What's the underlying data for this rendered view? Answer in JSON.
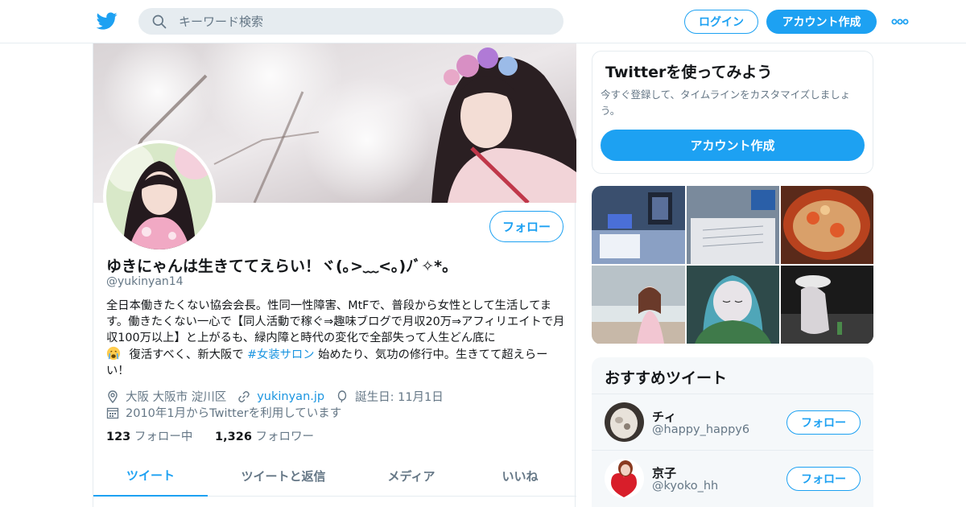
{
  "header": {
    "search_placeholder": "キーワード検索",
    "login_label": "ログイン",
    "signup_label": "アカウント作成",
    "brand_color": "#1da1f2"
  },
  "profile": {
    "display_name": "ゆきにゃんは生きててえらい！ヾ(｡>﹏<｡)ﾉﾞ✧*。",
    "handle": "@yukinyan14",
    "follow_label": "フォロー",
    "bio_line1": "全日本働きたくない協会会長。性同一性障害、MtFで、普段から女性として生活してます。働きたくない一心で【同人活動で稼ぐ⇒趣味ブログで月収20万⇒アフィリエイトで月収100万以上】と上がるも、緑内障と時代の変化で全部失って人生どん底に",
    "bio_line2_before": "復活すべく、新大阪で",
    "bio_hashtag": "#女装サロン",
    "bio_line2_after": "始めたり、気功の修行中。生きてて超えらーい！",
    "location": "大阪 大阪市 淀川区",
    "website": "yukinyan.jp",
    "birthday": "誕生日: 11月1日",
    "joined": "2010年1月からTwitterを利用しています",
    "following_count": "123",
    "following_label": "フォロー中",
    "followers_count": "1,326",
    "followers_label": "フォロワー",
    "tabs": [
      {
        "label": "ツイート"
      },
      {
        "label": "ツイートと返信"
      },
      {
        "label": "メディア"
      },
      {
        "label": "いいね"
      }
    ]
  },
  "sidebar": {
    "signup_title": "Twitterを使ってみよう",
    "signup_text": "今すぐ登録して、タイムラインをカスタマイズしましょう。",
    "signup_button": "アカウント作成",
    "recommended_title": "おすすめツイート",
    "recommended": [
      {
        "name": "チィ",
        "handle": "@happy_happy6",
        "follow_label": "フォロー"
      },
      {
        "name": "京子",
        "handle": "@kyoko_hh",
        "follow_label": "フォロー"
      }
    ]
  }
}
